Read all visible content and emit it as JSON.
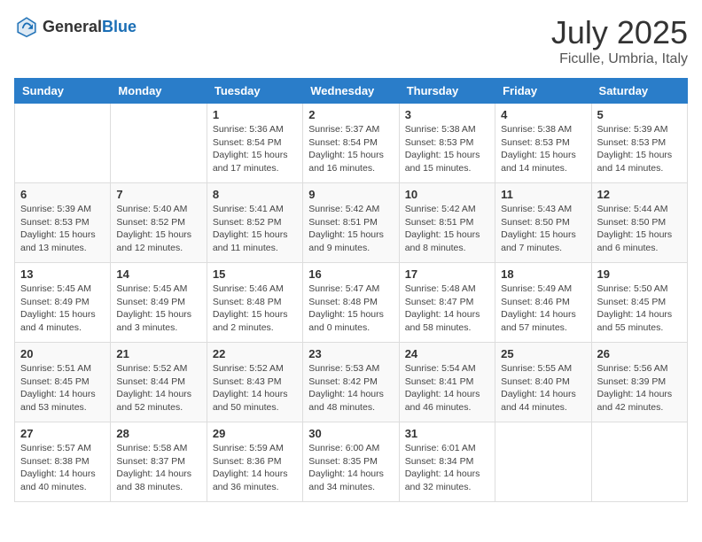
{
  "header": {
    "logo_general": "General",
    "logo_blue": "Blue",
    "month_title": "July 2025",
    "location": "Ficulle, Umbria, Italy"
  },
  "days_of_week": [
    "Sunday",
    "Monday",
    "Tuesday",
    "Wednesday",
    "Thursday",
    "Friday",
    "Saturday"
  ],
  "weeks": [
    [
      {
        "day": "",
        "info": ""
      },
      {
        "day": "",
        "info": ""
      },
      {
        "day": "1",
        "info": "Sunrise: 5:36 AM\nSunset: 8:54 PM\nDaylight: 15 hours and 17 minutes."
      },
      {
        "day": "2",
        "info": "Sunrise: 5:37 AM\nSunset: 8:54 PM\nDaylight: 15 hours and 16 minutes."
      },
      {
        "day": "3",
        "info": "Sunrise: 5:38 AM\nSunset: 8:53 PM\nDaylight: 15 hours and 15 minutes."
      },
      {
        "day": "4",
        "info": "Sunrise: 5:38 AM\nSunset: 8:53 PM\nDaylight: 15 hours and 14 minutes."
      },
      {
        "day": "5",
        "info": "Sunrise: 5:39 AM\nSunset: 8:53 PM\nDaylight: 15 hours and 14 minutes."
      }
    ],
    [
      {
        "day": "6",
        "info": "Sunrise: 5:39 AM\nSunset: 8:53 PM\nDaylight: 15 hours and 13 minutes."
      },
      {
        "day": "7",
        "info": "Sunrise: 5:40 AM\nSunset: 8:52 PM\nDaylight: 15 hours and 12 minutes."
      },
      {
        "day": "8",
        "info": "Sunrise: 5:41 AM\nSunset: 8:52 PM\nDaylight: 15 hours and 11 minutes."
      },
      {
        "day": "9",
        "info": "Sunrise: 5:42 AM\nSunset: 8:51 PM\nDaylight: 15 hours and 9 minutes."
      },
      {
        "day": "10",
        "info": "Sunrise: 5:42 AM\nSunset: 8:51 PM\nDaylight: 15 hours and 8 minutes."
      },
      {
        "day": "11",
        "info": "Sunrise: 5:43 AM\nSunset: 8:50 PM\nDaylight: 15 hours and 7 minutes."
      },
      {
        "day": "12",
        "info": "Sunrise: 5:44 AM\nSunset: 8:50 PM\nDaylight: 15 hours and 6 minutes."
      }
    ],
    [
      {
        "day": "13",
        "info": "Sunrise: 5:45 AM\nSunset: 8:49 PM\nDaylight: 15 hours and 4 minutes."
      },
      {
        "day": "14",
        "info": "Sunrise: 5:45 AM\nSunset: 8:49 PM\nDaylight: 15 hours and 3 minutes."
      },
      {
        "day": "15",
        "info": "Sunrise: 5:46 AM\nSunset: 8:48 PM\nDaylight: 15 hours and 2 minutes."
      },
      {
        "day": "16",
        "info": "Sunrise: 5:47 AM\nSunset: 8:48 PM\nDaylight: 15 hours and 0 minutes."
      },
      {
        "day": "17",
        "info": "Sunrise: 5:48 AM\nSunset: 8:47 PM\nDaylight: 14 hours and 58 minutes."
      },
      {
        "day": "18",
        "info": "Sunrise: 5:49 AM\nSunset: 8:46 PM\nDaylight: 14 hours and 57 minutes."
      },
      {
        "day": "19",
        "info": "Sunrise: 5:50 AM\nSunset: 8:45 PM\nDaylight: 14 hours and 55 minutes."
      }
    ],
    [
      {
        "day": "20",
        "info": "Sunrise: 5:51 AM\nSunset: 8:45 PM\nDaylight: 14 hours and 53 minutes."
      },
      {
        "day": "21",
        "info": "Sunrise: 5:52 AM\nSunset: 8:44 PM\nDaylight: 14 hours and 52 minutes."
      },
      {
        "day": "22",
        "info": "Sunrise: 5:52 AM\nSunset: 8:43 PM\nDaylight: 14 hours and 50 minutes."
      },
      {
        "day": "23",
        "info": "Sunrise: 5:53 AM\nSunset: 8:42 PM\nDaylight: 14 hours and 48 minutes."
      },
      {
        "day": "24",
        "info": "Sunrise: 5:54 AM\nSunset: 8:41 PM\nDaylight: 14 hours and 46 minutes."
      },
      {
        "day": "25",
        "info": "Sunrise: 5:55 AM\nSunset: 8:40 PM\nDaylight: 14 hours and 44 minutes."
      },
      {
        "day": "26",
        "info": "Sunrise: 5:56 AM\nSunset: 8:39 PM\nDaylight: 14 hours and 42 minutes."
      }
    ],
    [
      {
        "day": "27",
        "info": "Sunrise: 5:57 AM\nSunset: 8:38 PM\nDaylight: 14 hours and 40 minutes."
      },
      {
        "day": "28",
        "info": "Sunrise: 5:58 AM\nSunset: 8:37 PM\nDaylight: 14 hours and 38 minutes."
      },
      {
        "day": "29",
        "info": "Sunrise: 5:59 AM\nSunset: 8:36 PM\nDaylight: 14 hours and 36 minutes."
      },
      {
        "day": "30",
        "info": "Sunrise: 6:00 AM\nSunset: 8:35 PM\nDaylight: 14 hours and 34 minutes."
      },
      {
        "day": "31",
        "info": "Sunrise: 6:01 AM\nSunset: 8:34 PM\nDaylight: 14 hours and 32 minutes."
      },
      {
        "day": "",
        "info": ""
      },
      {
        "day": "",
        "info": ""
      }
    ]
  ]
}
